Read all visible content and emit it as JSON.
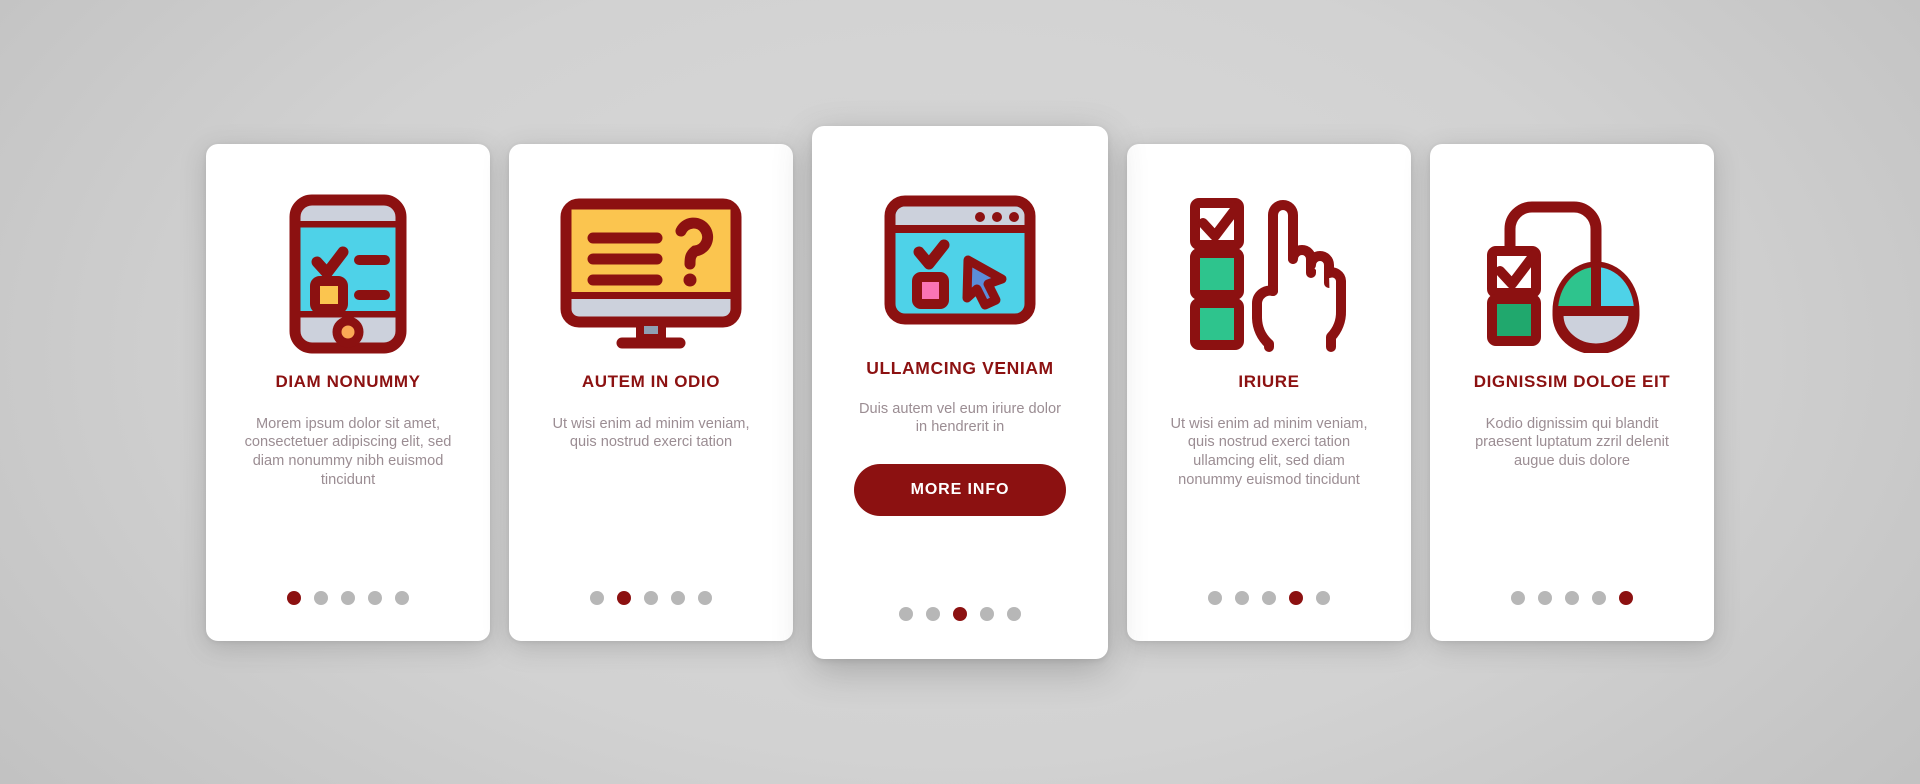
{
  "theme": {
    "primary": "#8C1111",
    "body_text": "#9b8d93",
    "card_bg": "#ffffff",
    "page_bg": "#d2d2d2",
    "dot_inactive": "#b7b7b7",
    "accent_cyan": "#4ed2e8",
    "accent_yellow": "#fbc54f",
    "accent_green": "#2ec48d",
    "accent_pink": "#fa74b4",
    "accent_blue": "#5b8dd9",
    "accent_gray": "#ccd1dc"
  },
  "cards": [
    {
      "icon": "mobile-checklist-icon",
      "title": "DIAM NONUMMY",
      "body": "Morem ipsum dolor sit amet, consectetuer adipiscing elit, sed diam nonummy nibh euismod tincidunt",
      "dots": {
        "count": 5,
        "active": 0
      },
      "featured": false
    },
    {
      "icon": "monitor-question-icon",
      "title": "AUTEM IN ODIO",
      "body": "Ut wisi enim ad minim veniam, quis nostrud exerci tation",
      "dots": {
        "count": 5,
        "active": 1
      },
      "featured": false
    },
    {
      "icon": "browser-cursor-icon",
      "title": "ULLAMCING VENIAM",
      "body": "Duis autem vel eum iriure dolor in hendrerit in",
      "button_label": "MORE INFO",
      "dots": {
        "count": 5,
        "active": 2
      },
      "featured": true
    },
    {
      "icon": "hand-pointer-checklist-icon",
      "title": "IRIURE",
      "body": "Ut wisi enim ad minim veniam, quis nostrud exerci tation ullamcing elit, sed diam nonummy euismod tincidunt",
      "dots": {
        "count": 5,
        "active": 3
      },
      "featured": false
    },
    {
      "icon": "mouse-checklist-icon",
      "title": "DIGNISSIM DOLOE EIT",
      "body": "Kodio dignissim qui blandit praesent luptatum zzril delenit augue duis dolore",
      "dots": {
        "count": 5,
        "active": 4
      },
      "featured": false
    }
  ]
}
